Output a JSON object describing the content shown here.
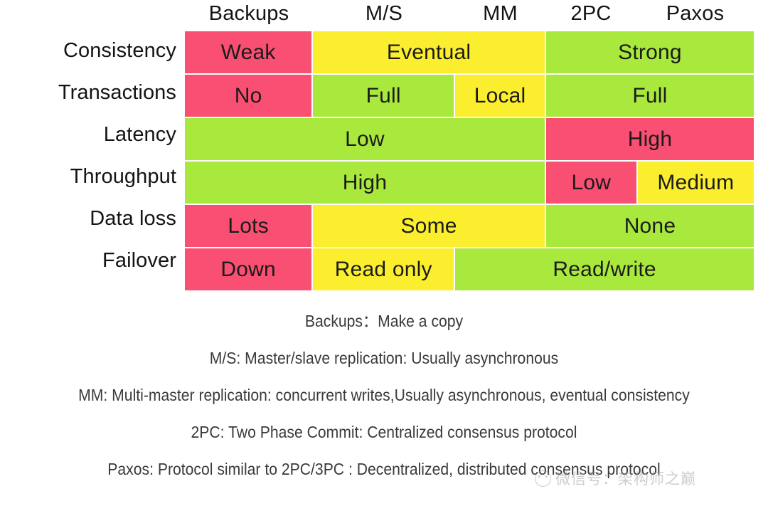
{
  "table": {
    "column_headers": [
      "Backups",
      "M/S",
      "MM",
      "2PC",
      "Paxos"
    ],
    "row_labels": [
      "Consistency",
      "Transactions",
      "Latency",
      "Throughput",
      "Data loss",
      "Failover"
    ],
    "colors": {
      "red": "#f84f72",
      "yellow": "#fbee2e",
      "green": "#a9e83c"
    },
    "rows": [
      {
        "label": "Consistency",
        "cells": [
          {
            "text": "Weak",
            "color": "red",
            "span": "Backups"
          },
          {
            "text": "Eventual",
            "color": "yellow",
            "span": "M/S+MM"
          },
          {
            "text": "Strong",
            "color": "green",
            "span": "2PC+Paxos"
          }
        ]
      },
      {
        "label": "Transactions",
        "cells": [
          {
            "text": "No",
            "color": "red",
            "span": "Backups"
          },
          {
            "text": "Full",
            "color": "green",
            "span": "M/S"
          },
          {
            "text": "Local",
            "color": "yellow",
            "span": "MM"
          },
          {
            "text": "Full",
            "color": "green",
            "span": "2PC+Paxos"
          }
        ]
      },
      {
        "label": "Latency",
        "cells": [
          {
            "text": "Low",
            "color": "green",
            "span": "Backups+M/S+MM"
          },
          {
            "text": "High",
            "color": "red",
            "span": "2PC+Paxos"
          }
        ]
      },
      {
        "label": "Throughput",
        "cells": [
          {
            "text": "High",
            "color": "green",
            "span": "Backups+M/S+MM"
          },
          {
            "text": "Low",
            "color": "red",
            "span": "2PC"
          },
          {
            "text": "Medium",
            "color": "yellow",
            "span": "Paxos"
          }
        ]
      },
      {
        "label": "Data loss",
        "cells": [
          {
            "text": "Lots",
            "color": "red",
            "span": "Backups"
          },
          {
            "text": "Some",
            "color": "yellow",
            "span": "M/S+MM"
          },
          {
            "text": "None",
            "color": "green",
            "span": "2PC+Paxos"
          }
        ]
      },
      {
        "label": "Failover",
        "cells": [
          {
            "text": "Down",
            "color": "red",
            "span": "Backups"
          },
          {
            "text": "Read only",
            "color": "yellow",
            "span": "M/S"
          },
          {
            "text": "Read/write",
            "color": "green",
            "span": "MM+2PC+Paxos"
          }
        ]
      }
    ]
  },
  "legend": {
    "lines": [
      "Backups：Make a copy",
      "M/S: Master/slave replication: Usually asynchronous",
      "MM: Multi-master replication: concurrent writes,Usually asynchronous, eventual consistency",
      "2PC: Two Phase Commit: Centralized consensus protocol",
      "Paxos: Protocol similar to 2PC/3PC : Decentralized, distributed consensus protocol"
    ]
  },
  "watermark": {
    "text": "微信号：架构师之巅"
  }
}
